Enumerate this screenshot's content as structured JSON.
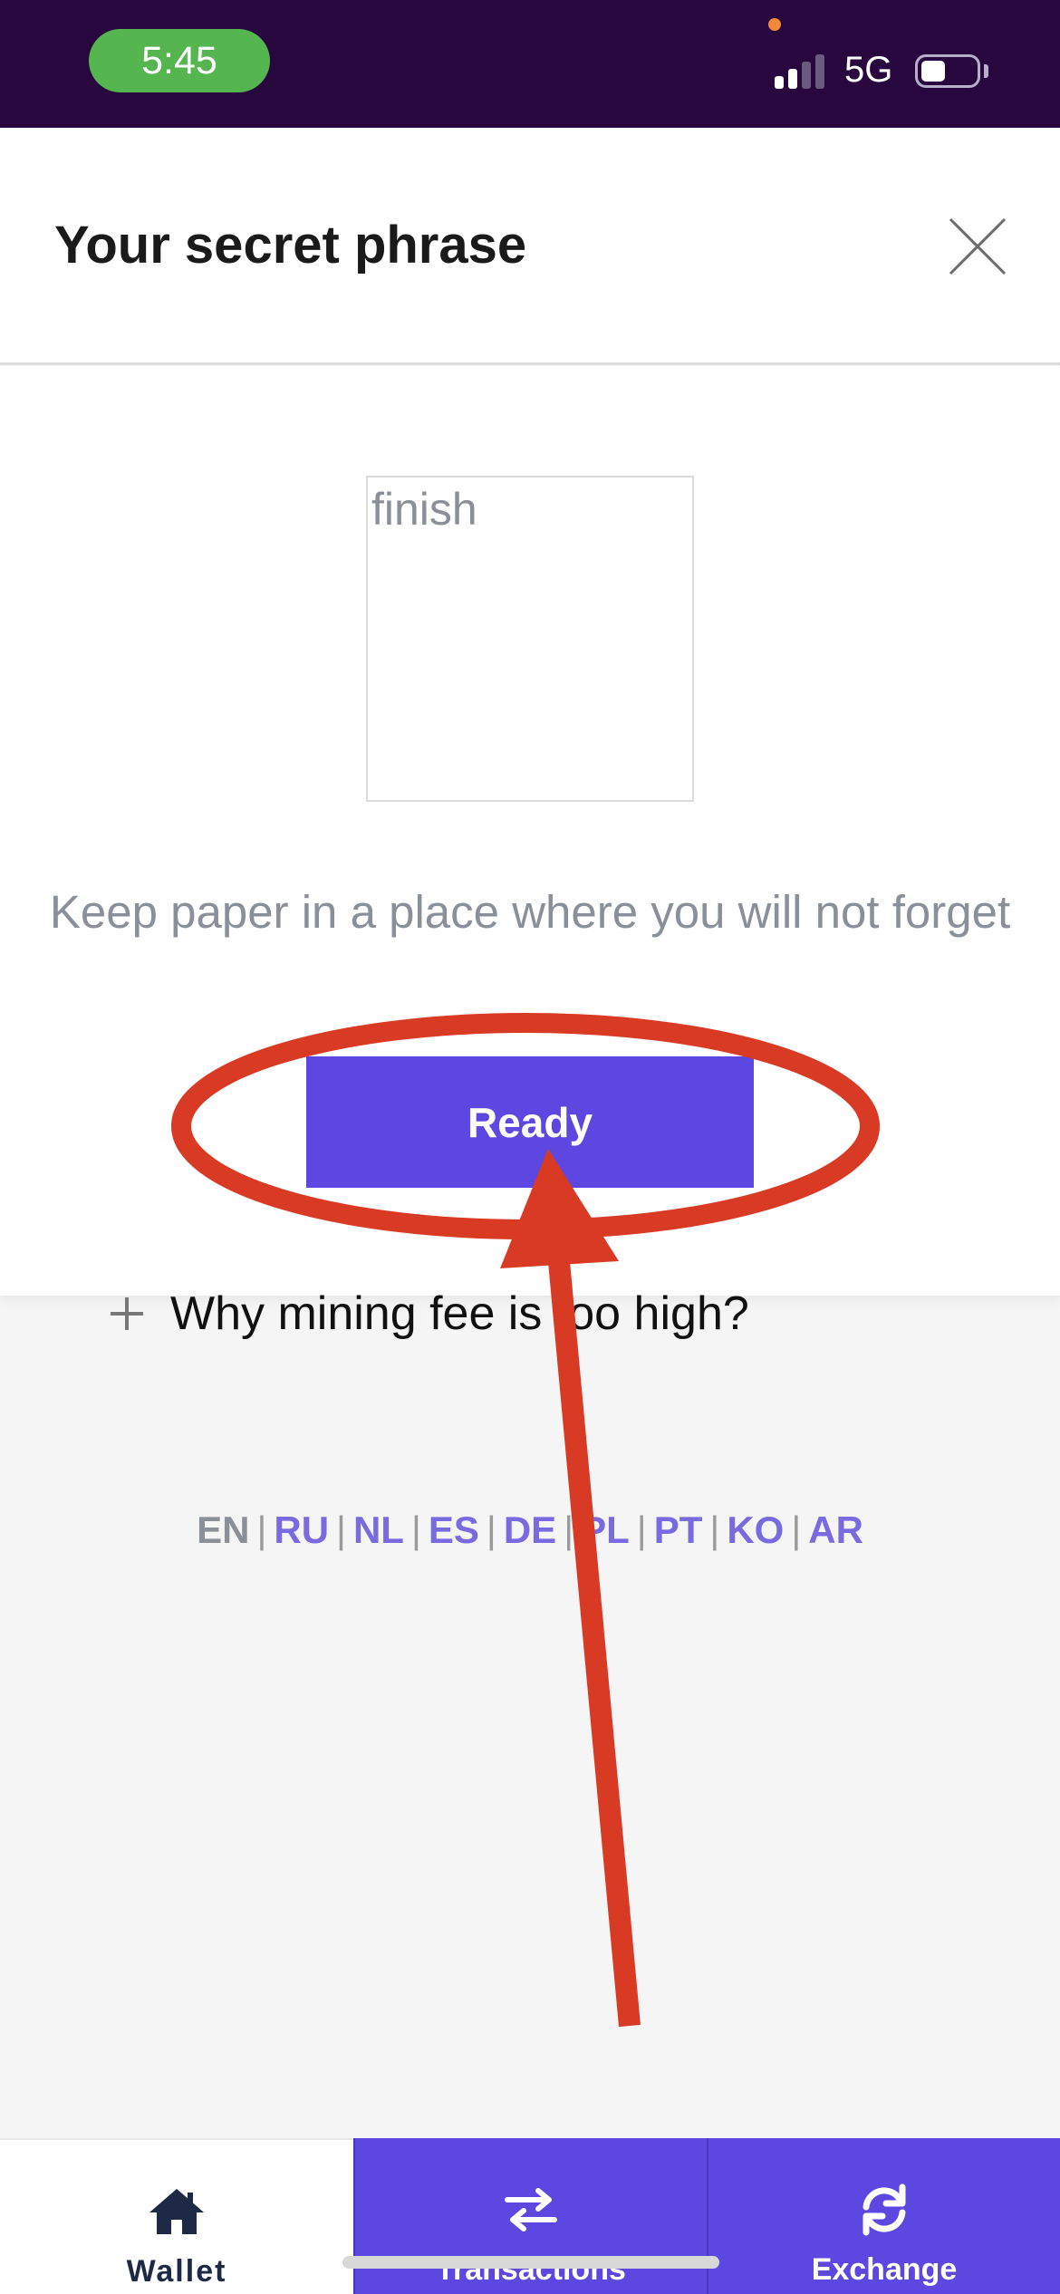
{
  "status_bar": {
    "time": "5:45",
    "network": "5G",
    "battery_level": 0.35
  },
  "modal": {
    "title": "Your secret phrase",
    "close_icon": "close-icon",
    "phrase_word": "finish",
    "hint": "Keep paper in a place where you will not forget",
    "ready_label": "Ready"
  },
  "faq": {
    "question": "Why mining fee is too high?"
  },
  "languages": {
    "current": "EN",
    "items": [
      "EN",
      "RU",
      "NL",
      "ES",
      "DE",
      "PL",
      "PT",
      "KO",
      "AR"
    ]
  },
  "tabs": [
    {
      "label": "Wallet",
      "icon": "home-icon",
      "active": true
    },
    {
      "label": "Transactions",
      "icon": "swap-arrows-icon",
      "active": false
    },
    {
      "label": "Exchange",
      "icon": "refresh-icon",
      "active": false
    }
  ],
  "colors": {
    "status_bar_bg": "#28073f",
    "time_pill": "#55b54f",
    "accent": "#5c48e0",
    "annotation": "#d93a23",
    "link": "#7a6ae0"
  }
}
